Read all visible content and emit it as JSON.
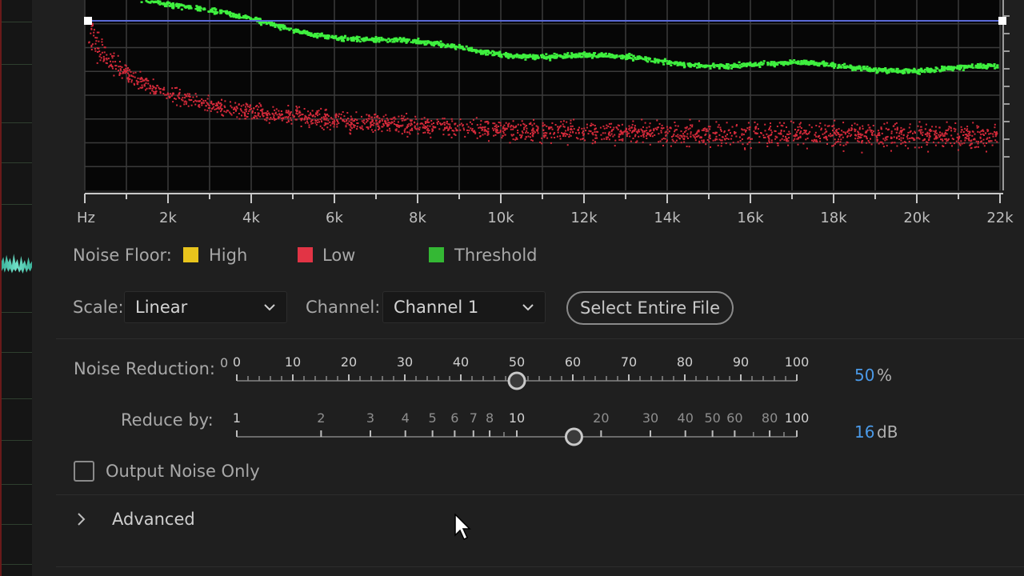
{
  "graph": {
    "x_tick_labels": [
      "Hz",
      "2k",
      "4k",
      "6k",
      "8k",
      "10k",
      "12k",
      "14k",
      "16k",
      "18k",
      "20k",
      "22k"
    ],
    "colors": {
      "background": "#060606",
      "grid": "#3a3a3a",
      "threshold_line": "#5a6ad8",
      "threshold_points": "#3ff03f",
      "low_points": "#d42a3a"
    }
  },
  "legend": {
    "label": "Noise Floor:",
    "items": [
      {
        "label": "High",
        "color": "#e8c41c"
      },
      {
        "label": "Low",
        "color": "#e23445"
      },
      {
        "label": "Threshold",
        "color": "#34b834"
      }
    ]
  },
  "scale": {
    "label": "Scale:",
    "value": "Linear"
  },
  "channel": {
    "label": "Channel:",
    "value": "Channel 1"
  },
  "select_entire_file": "Select Entire File",
  "noise_reduction": {
    "label": "Noise Reduction:",
    "min_label": "0",
    "tick_labels": [
      "0",
      "10",
      "20",
      "30",
      "40",
      "50",
      "60",
      "70",
      "80",
      "90",
      "100"
    ],
    "value": "50",
    "unit": "%",
    "fraction": 0.5
  },
  "reduce_by": {
    "label": "Reduce by:",
    "tick_labels": [
      "1",
      "2",
      "3",
      "4",
      "5",
      "6",
      "7",
      "8",
      "10",
      "20",
      "30",
      "40",
      "50",
      "60",
      "80",
      "100"
    ],
    "value": "16",
    "unit": "dB"
  },
  "output_noise_only": {
    "label": "Output Noise Only",
    "checked": false
  },
  "advanced": {
    "label": "Advanced"
  }
}
